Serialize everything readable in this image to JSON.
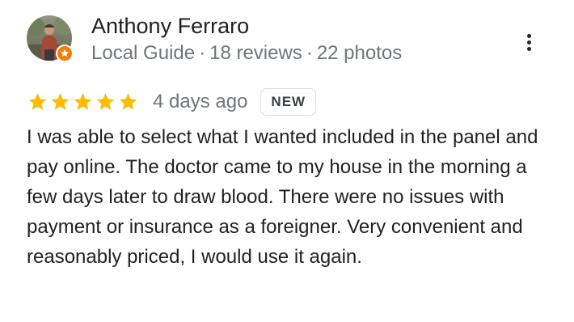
{
  "reviewer": {
    "name": "Anthony Ferraro",
    "badge": "Local Guide",
    "separator": "·",
    "reviews": "18 reviews",
    "photos": "22 photos"
  },
  "rating": {
    "stars": 5,
    "max_stars": 5,
    "date": "4 days ago",
    "new_badge": "NEW"
  },
  "review": {
    "text": "I was able to select what I wanted included in the panel and pay online. The doctor came to my house in the morning a few days later to draw blood. There were no issues with payment or insurance as a foreigner. Very convenient and reasonably priced, I would use it again."
  },
  "icons": {
    "star": "star-icon",
    "more": "more-vert-icon",
    "local_guide": "local-guide-badge-icon"
  },
  "colors": {
    "star": "#fbbc04",
    "local_guide_badge": "#f57c00",
    "name_text": "#202124",
    "meta_text": "#70757a",
    "badge_border": "#dadce0"
  }
}
